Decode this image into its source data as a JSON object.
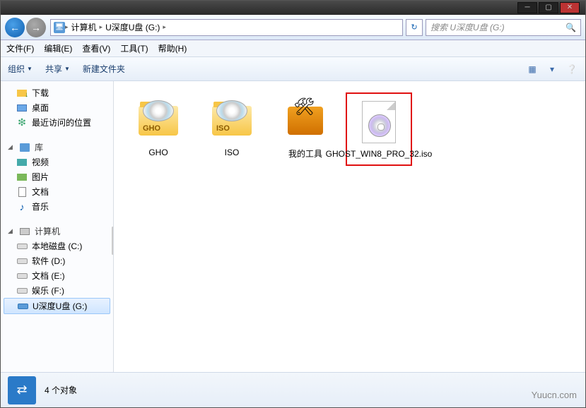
{
  "window_controls": {
    "min": "─",
    "max": "▢",
    "close": "✕"
  },
  "nav": {
    "back": "←",
    "forward": "→",
    "refresh": "↻"
  },
  "breadcrumb": {
    "root_icon": "💻",
    "items": [
      "计算机",
      "U深度U盘 (G:)"
    ],
    "sep": "▸"
  },
  "search": {
    "placeholder": "搜索 U深度U盘 (G:)",
    "icon": "🔍"
  },
  "menubar": [
    "文件(F)",
    "编辑(E)",
    "查看(V)",
    "工具(T)",
    "帮助(H)"
  ],
  "toolbar": {
    "organize": "组织",
    "share": "共享",
    "newfolder": "新建文件夹",
    "right_icons": [
      "▦",
      "▾",
      "❔"
    ]
  },
  "sidebar": {
    "favorites": {
      "items": [
        {
          "label": "下载",
          "icon": "dl"
        },
        {
          "label": "桌面",
          "icon": "desktop"
        },
        {
          "label": "最近访问的位置",
          "icon": "recent"
        }
      ]
    },
    "libraries": {
      "header": "库",
      "items": [
        {
          "label": "视频",
          "icon": "video"
        },
        {
          "label": "图片",
          "icon": "pic"
        },
        {
          "label": "文档",
          "icon": "doc"
        },
        {
          "label": "音乐",
          "icon": "music"
        }
      ]
    },
    "computer": {
      "header": "计算机",
      "items": [
        {
          "label": "本地磁盘 (C:)",
          "icon": "drive"
        },
        {
          "label": "软件 (D:)",
          "icon": "drive"
        },
        {
          "label": "文档 (E:)",
          "icon": "drive"
        },
        {
          "label": "娱乐 (F:)",
          "icon": "drive"
        },
        {
          "label": "U深度U盘 (G:)",
          "icon": "usb",
          "selected": true
        }
      ]
    }
  },
  "files": [
    {
      "name": "GHO",
      "type": "folder-disc",
      "tag": "GHO"
    },
    {
      "name": "ISO",
      "type": "folder-disc",
      "tag": "ISO"
    },
    {
      "name": "我的工具",
      "type": "toolbox"
    },
    {
      "name": "GHOST_WIN8_PRO_32.iso",
      "type": "iso",
      "highlighted": true
    }
  ],
  "status": {
    "icon": "⇄",
    "text": "4 个对象"
  },
  "watermark": "Yuucn.com"
}
